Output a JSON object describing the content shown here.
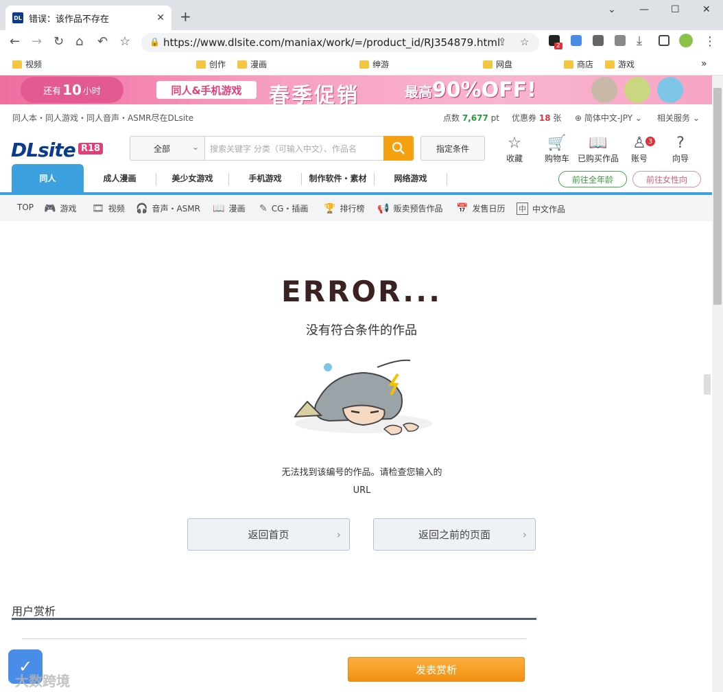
{
  "browser": {
    "tab_title": "错误：该作品不存在",
    "favicon_text": "DL",
    "url": "https://www.dlsite.com/maniax/work/=/product_id/RJ354879.html",
    "extension_badge": "2",
    "bookmarks": [
      "视频",
      "创作",
      "漫画",
      "绅游",
      "网盘",
      "商店",
      "游戏"
    ],
    "bookmark_more": "»"
  },
  "banner": {
    "countdown_pre": "还有",
    "countdown_num": "10",
    "countdown_unit": "小时",
    "pill": "同人&手机游戏",
    "headline": "春季促销",
    "discount_pre": "最高",
    "discount": "90%OFF!"
  },
  "site": {
    "tagline": "同人本・同人游戏・同人音声・ASMR尽在DLsite",
    "points_label": "点数",
    "points_value": "7,677",
    "points_unit": "pt",
    "coupon_label": "优惠券",
    "coupon_value": "18",
    "coupon_unit": "张",
    "language": "简体中文-JPY",
    "related": "相关服务"
  },
  "header": {
    "logo": "DLsite",
    "r18": "R18",
    "search_category": "全部",
    "search_placeholder": "搜索关键字 分类（可输入中文）、作品名",
    "cond_button": "指定条件",
    "icons": [
      {
        "label": "收藏"
      },
      {
        "label": "购物车"
      },
      {
        "label": "已购买作品"
      },
      {
        "label": "账号",
        "badge": "3"
      },
      {
        "label": "向导"
      }
    ]
  },
  "global_nav": {
    "tabs": [
      "同人",
      "成人漫画",
      "美少女游戏",
      "手机游戏",
      "制作软件・素材",
      "网络游戏"
    ],
    "all_ages": "前往全年龄",
    "female": "前往女性向"
  },
  "sub_nav": [
    {
      "label": "TOP"
    },
    {
      "label": "游戏"
    },
    {
      "label": "视频"
    },
    {
      "label": "音声・ASMR"
    },
    {
      "label": "漫画"
    },
    {
      "label": "CG・插画"
    },
    {
      "label": "排行榜"
    },
    {
      "label": "贩卖预告作品"
    },
    {
      "label": "发售日历"
    },
    {
      "label": "中文作品"
    }
  ],
  "error": {
    "title": "ERROR...",
    "subtitle": "没有符合条件的作品",
    "description_line1": "无法找到该编号的作品。请检查您输入的",
    "description_line2": "URL",
    "btn_home": "返回首页",
    "btn_back": "返回之前的页面"
  },
  "review": {
    "heading": "用户赏析",
    "post_button": "发表赏析"
  },
  "watermark": "大数跨境",
  "colors": {
    "brand_blue": "#0b3b8c",
    "nav_blue": "#3da1e0",
    "accent_orange": "#f5a010",
    "pink": "#e0407a"
  }
}
